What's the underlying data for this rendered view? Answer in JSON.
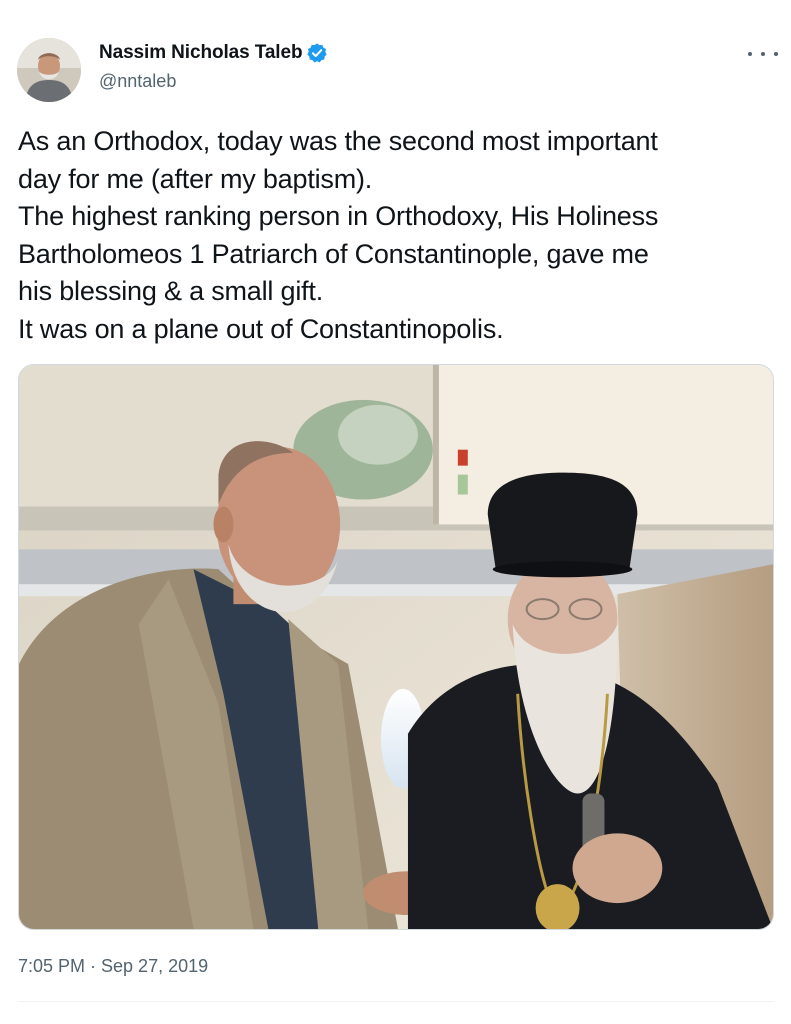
{
  "author": {
    "display_name": "Nassim Nicholas Taleb",
    "handle": "@nntaleb",
    "verified_icon": "verified-badge-icon",
    "avatar_icon": "profile-avatar"
  },
  "menu": {
    "icon": "more-options-icon"
  },
  "tweet": {
    "lines": [
      "As an Orthodox, today was the second most important",
      "day for me (after my baptism).",
      "The highest ranking person in Orthodoxy, His Holiness",
      "Bartholomeos 1 Patriarch of Constantinople, gave me",
      "his blessing & a small gift.",
      "It was on a plane out of Constantinopolis."
    ]
  },
  "media": {
    "type": "photo"
  },
  "meta": {
    "timestamp": "7:05 PM · Sep 27, 2019"
  },
  "colors": {
    "text": "#0f1419",
    "secondary": "#536471",
    "verified_blue": "#1d9bf0",
    "border": "#cfd9de"
  }
}
